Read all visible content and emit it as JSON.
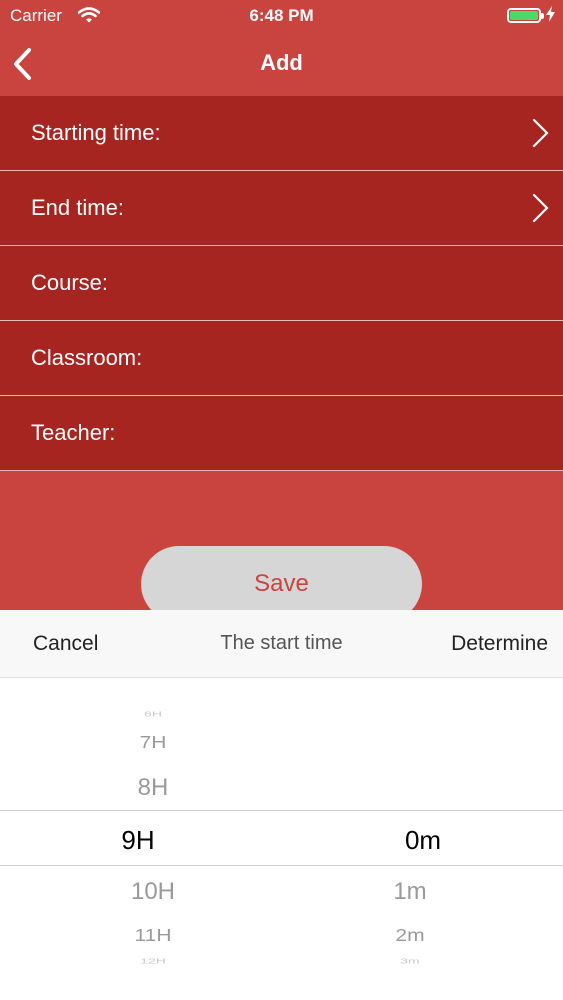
{
  "status_bar": {
    "carrier": "Carrier",
    "time": "6:48 PM",
    "battery_color": "#4cd964"
  },
  "nav": {
    "title": "Add",
    "back_icon": "chevron-left-icon"
  },
  "form": {
    "rows": [
      {
        "label": "Starting time:",
        "has_chevron": true
      },
      {
        "label": "End time:",
        "has_chevron": true
      },
      {
        "label": "Course:",
        "has_chevron": false
      },
      {
        "label": "Classroom:",
        "has_chevron": false
      },
      {
        "label": "Teacher:",
        "has_chevron": false
      }
    ]
  },
  "save_button": {
    "label": "Save"
  },
  "picker_sheet": {
    "cancel_label": "Cancel",
    "title": "The start time",
    "determine_label": "Determine",
    "hours": [
      "6H",
      "7H",
      "8H",
      "9H",
      "10H",
      "11H",
      "12H"
    ],
    "selected_hour": "9H",
    "minutes": [
      "0m",
      "1m",
      "2m",
      "3m"
    ],
    "selected_minute": "0m"
  },
  "colors": {
    "background": "#c9433f",
    "row_background": "#a72521",
    "save_button_background": "#d6d6d6",
    "save_button_text": "#c9433f"
  }
}
